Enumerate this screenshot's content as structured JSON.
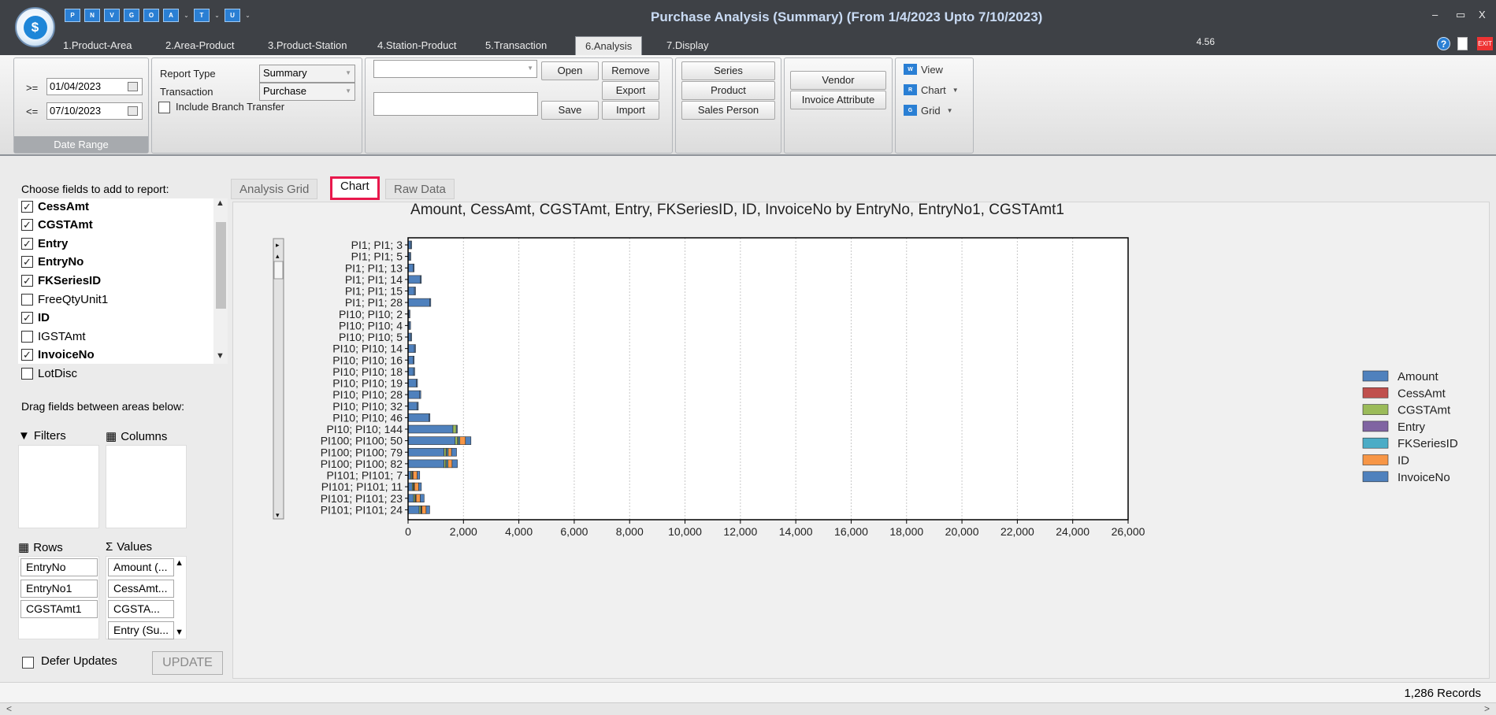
{
  "window": {
    "title": "Purchase Analysis (Summary) (From 1/4/2023 Upto 7/10/2023)",
    "logo_letter": "$",
    "minimize": "–",
    "maximize": "▭",
    "close": "X"
  },
  "quick_access": [
    {
      "label": "P",
      "has_dropdown": false
    },
    {
      "label": "N",
      "has_dropdown": false
    },
    {
      "label": "V",
      "has_dropdown": false
    },
    {
      "label": "G",
      "has_dropdown": false
    },
    {
      "label": "O",
      "has_dropdown": false
    },
    {
      "label": "A",
      "has_dropdown": true
    },
    {
      "label": "T",
      "has_dropdown": true
    },
    {
      "label": "U",
      "has_dropdown": true
    }
  ],
  "ribbon_tabs": [
    "1.Product-Area",
    "2.Area-Product",
    "3.Product-Station",
    "4.Station-Product",
    "5.Transaction",
    "6.Analysis",
    "7.Display"
  ],
  "active_ribbon_tab": "6.Analysis",
  "version": "4.56",
  "help_symbol": "?",
  "exit_text": "EXIT",
  "date_range": {
    "from_op": ">=",
    "from_date": "01/04/2023",
    "to_op": "<=",
    "to_date": "07/10/2023",
    "caption": "Date Range"
  },
  "report_options": {
    "report_type_label": "Report Type",
    "report_type_value": "Summary",
    "transaction_label": "Transaction",
    "transaction_value": "Purchase",
    "include_branch_label": "Include Branch Transfer",
    "include_branch_checked": false
  },
  "layout_buttons": {
    "open": "Open",
    "remove": "Remove",
    "export": "Export",
    "save": "Save",
    "import": "Import"
  },
  "filter_buttons": {
    "series": "Series",
    "product": "Product",
    "sales_person": "Sales Person",
    "vendor": "Vendor",
    "invoice_attribute": "Invoice Attribute"
  },
  "view_buttons": {
    "view": "View",
    "chart": "Chart",
    "grid": "Grid",
    "view_icon": "W",
    "chart_icon": "R",
    "grid_icon": "G"
  },
  "field_panel": {
    "choose_label": "Choose fields to add to report:",
    "fields": [
      {
        "name": "CessAmt",
        "checked": true
      },
      {
        "name": "CGSTAmt",
        "checked": true
      },
      {
        "name": "Entry",
        "checked": true
      },
      {
        "name": "EntryNo",
        "checked": true
      },
      {
        "name": "FKSeriesID",
        "checked": true
      },
      {
        "name": "FreeQtyUnit1",
        "checked": false
      },
      {
        "name": "ID",
        "checked": true
      },
      {
        "name": "IGSTAmt",
        "checked": false
      },
      {
        "name": "InvoiceNo",
        "checked": true
      },
      {
        "name": "LotDisc",
        "checked": false
      }
    ],
    "drag_label": "Drag fields between areas below:",
    "filters_label": "Filters",
    "columns_label": "Columns",
    "rows_label": "Rows",
    "values_label": "Values",
    "rows": [
      "EntryNo",
      "EntryNo1",
      "CGSTAmt1"
    ],
    "values": [
      "Amount (...",
      "CessAmt...",
      "CGSTA...",
      "Entry (Su..."
    ],
    "defer_label": "Defer Updates",
    "defer_checked": false,
    "update_label": "UPDATE"
  },
  "main_tabs": [
    "Analysis Grid",
    "Chart",
    "Raw Data"
  ],
  "active_main_tab": "Chart",
  "status": {
    "records": "1,286 Records"
  },
  "chart_data": {
    "type": "bar",
    "orientation": "horizontal",
    "stacked": true,
    "title": "Amount, CessAmt, CGSTAmt, Entry, FKSeriesID, ID, InvoiceNo by EntryNo, EntryNo1, CGSTAmt1",
    "xlim": [
      0,
      26000
    ],
    "x_ticks": [
      0,
      2000,
      4000,
      6000,
      8000,
      10000,
      12000,
      14000,
      16000,
      18000,
      20000,
      22000,
      24000,
      26000
    ],
    "x_tick_labels": [
      "0",
      "2,000",
      "4,000",
      "6,000",
      "8,000",
      "10,000",
      "12,000",
      "14,000",
      "16,000",
      "18,000",
      "20,000",
      "22,000",
      "24,000",
      "26,000"
    ],
    "grid": true,
    "legend_position": "right",
    "categories": [
      "PI1; PI1; 3",
      "PI1; PI1; 5",
      "PI1; PI1; 13",
      "PI1; PI1; 14",
      "PI1; PI1; 15",
      "PI1; PI1; 28",
      "PI10; PI10; 2",
      "PI10; PI10; 4",
      "PI10; PI10; 5",
      "PI10; PI10; 14",
      "PI10; PI10; 16",
      "PI10; PI10; 18",
      "PI10; PI10; 19",
      "PI10; PI10; 28",
      "PI10; PI10; 32",
      "PI10; PI10; 46",
      "PI10; PI10; 144",
      "PI100; PI100; 50",
      "PI100; PI100; 79",
      "PI100; PI100; 82",
      "PI101; PI101; 7",
      "PI101; PI101; 11",
      "PI101; PI101; 23",
      "PI101; PI101; 24"
    ],
    "series": [
      {
        "name": "Amount",
        "color": "#4f81bd",
        "values": [
          90,
          60,
          180,
          440,
          230,
          780,
          30,
          50,
          90,
          230,
          180,
          200,
          300,
          420,
          330,
          750,
          1620,
          1700,
          1300,
          1300,
          100,
          150,
          200,
          400
        ]
      },
      {
        "name": "CessAmt",
        "color": "#c0504d",
        "values": [
          0,
          0,
          0,
          0,
          0,
          0,
          0,
          0,
          0,
          0,
          0,
          0,
          0,
          0,
          0,
          0,
          0,
          0,
          0,
          0,
          0,
          0,
          0,
          0
        ]
      },
      {
        "name": "CGSTAmt",
        "color": "#9bbb59",
        "values": [
          0,
          0,
          0,
          0,
          0,
          0,
          0,
          0,
          0,
          0,
          0,
          0,
          0,
          0,
          0,
          0,
          120,
          90,
          70,
          60,
          40,
          40,
          50,
          60
        ]
      },
      {
        "name": "Entry",
        "color": "#8064a2",
        "values": [
          0,
          0,
          0,
          0,
          0,
          0,
          0,
          0,
          0,
          0,
          0,
          0,
          0,
          0,
          0,
          0,
          0,
          30,
          30,
          30,
          20,
          20,
          20,
          20
        ]
      },
      {
        "name": "FKSeriesID",
        "color": "#4bacc6",
        "values": [
          0,
          0,
          0,
          0,
          0,
          0,
          0,
          0,
          0,
          0,
          0,
          0,
          0,
          0,
          0,
          0,
          0,
          50,
          50,
          50,
          20,
          20,
          20,
          20
        ]
      },
      {
        "name": "ID",
        "color": "#f79646",
        "values": [
          0,
          0,
          0,
          0,
          0,
          0,
          0,
          0,
          0,
          0,
          0,
          0,
          0,
          0,
          0,
          0,
          0,
          200,
          120,
          150,
          150,
          150,
          150,
          150
        ]
      },
      {
        "name": "InvoiceNo",
        "color": "#4f81bd",
        "values": [
          40,
          40,
          40,
          40,
          40,
          40,
          40,
          40,
          40,
          40,
          40,
          40,
          40,
          40,
          40,
          40,
          40,
          200,
          180,
          190,
          90,
          100,
          140,
          130
        ]
      }
    ]
  }
}
